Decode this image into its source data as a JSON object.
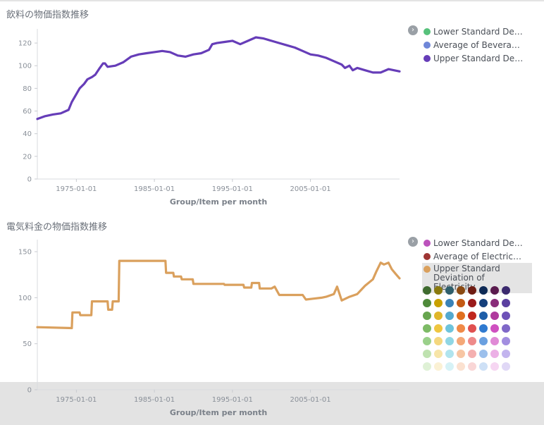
{
  "panels": [
    {
      "title": "飲料の物価指数推移",
      "xlabel": "Group/Item per month",
      "x_tick_labels": [
        "1975-01-01",
        "1985-01-01",
        "1995-01-01",
        "2005-01-01"
      ],
      "y_tick_labels": [
        "0",
        "20",
        "40",
        "60",
        "80",
        "100",
        "120"
      ],
      "legend": [
        {
          "label": "Lower Standard Devi...",
          "color": "#57c17b"
        },
        {
          "label": "Average of Beverages",
          "color": "#6f87d8"
        },
        {
          "label": "Upper Standard Devi...",
          "color": "#663db8"
        }
      ]
    },
    {
      "title": "電気料金の物価指数推移",
      "xlabel": "Group/Item per month",
      "x_tick_labels": [
        "1975-01-01",
        "1985-01-01",
        "1995-01-01",
        "2005-01-01"
      ],
      "y_tick_labels": [
        "0",
        "50",
        "100",
        "150"
      ],
      "legend": [
        {
          "label": "Lower Standard Devi...",
          "color": "#bc52bc"
        },
        {
          "label": "Average of Electricity",
          "color": "#9e3533"
        },
        {
          "label": "Upper Standard Deviation of Electricity",
          "color": "#daa05d"
        }
      ],
      "palette": [
        [
          "#3f6b2f",
          "#8a7a0e",
          "#2e5e6b",
          "#8a4a12",
          "#6e1c12",
          "#0e2a55",
          "#5a1b4e",
          "#3b2a6e"
        ],
        [
          "#4f8a3a",
          "#c9a100",
          "#3a82b8",
          "#c45a14",
          "#9a1b1b",
          "#15407c",
          "#8a2c7a",
          "#5a3fa0"
        ],
        [
          "#67a54f",
          "#e0b62a",
          "#54a9cf",
          "#e07020",
          "#c0271e",
          "#1e5ea8",
          "#b03a9e",
          "#6e52b8"
        ],
        [
          "#7dbb66",
          "#efc640",
          "#6ec4dc",
          "#f08a48",
          "#e05050",
          "#2f7ad0",
          "#cf50c0",
          "#8068c8"
        ],
        [
          "#9ad08a",
          "#f4d77e",
          "#90d6e4",
          "#f4a878",
          "#ee8a8a",
          "#6aa0e0",
          "#e08ad6",
          "#a28ee0"
        ],
        [
          "#bfe2b0",
          "#f7e5a8",
          "#b0e4ee",
          "#f7c6a4",
          "#f4b0b0",
          "#9cc0ec",
          "#ecb0e6",
          "#c2b4ee"
        ],
        [
          "#dff1d6",
          "#fbf1d4",
          "#d6f2f6",
          "#fbe1d0",
          "#f9d6d6",
          "#cde0f6",
          "#f6d6f2",
          "#e0d8f6"
        ]
      ]
    }
  ],
  "chart_data": [
    {
      "type": "line",
      "title": "飲料の物価指数推移",
      "xlabel": "Group/Item per month",
      "ylabel": "",
      "xlim": [
        "1970-01-01",
        "2016-06-01"
      ],
      "ylim": [
        0,
        130
      ],
      "x_ticks": [
        "1975-01-01",
        "1985-01-01",
        "1995-01-01",
        "2005-01-01"
      ],
      "y_ticks": [
        0,
        20,
        40,
        60,
        80,
        100,
        120
      ],
      "grid": false,
      "legend_position": "right",
      "series": [
        {
          "name": "Upper Standard Devi...",
          "color": "#663db8",
          "points": [
            [
              "1970-01-01",
              53
            ],
            [
              "1971-01-01",
              55.5
            ],
            [
              "1972-01-01",
              57
            ],
            [
              "1973-01-01",
              58
            ],
            [
              "1974-01-01",
              61
            ],
            [
              "1974-06-01",
              68
            ],
            [
              "1975-01-01",
              75
            ],
            [
              "1975-06-01",
              80
            ],
            [
              "1976-01-01",
              84
            ],
            [
              "1976-06-01",
              88
            ],
            [
              "1977-01-01",
              90
            ],
            [
              "1977-06-01",
              92
            ],
            [
              "1978-01-01",
              98
            ],
            [
              "1978-06-01",
              102
            ],
            [
              "1978-09-01",
              102
            ],
            [
              "1979-01-01",
              99
            ],
            [
              "1980-01-01",
              100
            ],
            [
              "1981-01-01",
              103
            ],
            [
              "1982-01-01",
              108
            ],
            [
              "1983-01-01",
              110
            ],
            [
              "1984-01-01",
              111
            ],
            [
              "1985-01-01",
              112
            ],
            [
              "1986-01-01",
              113
            ],
            [
              "1987-01-01",
              112
            ],
            [
              "1988-01-01",
              109
            ],
            [
              "1989-01-01",
              108
            ],
            [
              "1990-01-01",
              110
            ],
            [
              "1991-01-01",
              111
            ],
            [
              "1992-01-01",
              114
            ],
            [
              "1992-06-01",
              119
            ],
            [
              "1993-01-01",
              120
            ],
            [
              "1994-01-01",
              121
            ],
            [
              "1995-01-01",
              122
            ],
            [
              "1996-01-01",
              119
            ],
            [
              "1997-01-01",
              122
            ],
            [
              "1998-01-01",
              125
            ],
            [
              "1999-01-01",
              124
            ],
            [
              "2000-01-01",
              122
            ],
            [
              "2001-01-01",
              120
            ],
            [
              "2002-01-01",
              118
            ],
            [
              "2003-01-01",
              116
            ],
            [
              "2004-01-01",
              113
            ],
            [
              "2005-01-01",
              110
            ],
            [
              "2006-01-01",
              109
            ],
            [
              "2007-01-01",
              107
            ],
            [
              "2008-01-01",
              104
            ],
            [
              "2009-01-01",
              101
            ],
            [
              "2009-06-01",
              98
            ],
            [
              "2010-01-01",
              100
            ],
            [
              "2010-06-01",
              96
            ],
            [
              "2011-01-01",
              98
            ],
            [
              "2012-01-01",
              96
            ],
            [
              "2013-01-01",
              94
            ],
            [
              "2014-01-01",
              94
            ],
            [
              "2015-01-01",
              97
            ],
            [
              "2016-06-01",
              95
            ]
          ]
        }
      ]
    },
    {
      "type": "line",
      "title": "電気料金の物価指数推移",
      "xlabel": "Group/Item per month",
      "ylabel": "",
      "xlim": [
        "1970-01-01",
        "2016-06-01"
      ],
      "ylim": [
        0,
        160
      ],
      "x_ticks": [
        "1975-01-01",
        "1985-01-01",
        "1995-01-01",
        "2005-01-01"
      ],
      "y_ticks": [
        0,
        50,
        100,
        150
      ],
      "grid": false,
      "legend_position": "right",
      "series": [
        {
          "name": "Upper Standard Deviation of Electricity",
          "color": "#daa05d",
          "points": [
            [
              "1970-01-01",
              68
            ],
            [
              "1974-06-01",
              67
            ],
            [
              "1974-07-01",
              84
            ],
            [
              "1975-06-01",
              84
            ],
            [
              "1975-07-01",
              81
            ],
            [
              "1976-12-01",
              81
            ],
            [
              "1977-01-01",
              96
            ],
            [
              "1979-01-01",
              96
            ],
            [
              "1979-02-01",
              87
            ],
            [
              "1979-08-01",
              87
            ],
            [
              "1979-09-01",
              96
            ],
            [
              "1980-06-01",
              96
            ],
            [
              "1980-07-01",
              140
            ],
            [
              "1986-06-01",
              140
            ],
            [
              "1986-07-01",
              127
            ],
            [
              "1987-06-01",
              127
            ],
            [
              "1987-07-01",
              123
            ],
            [
              "1988-06-01",
              123
            ],
            [
              "1988-07-01",
              120
            ],
            [
              "1989-12-01",
              120
            ],
            [
              "1990-01-01",
              115
            ],
            [
              "1993-12-01",
              115
            ],
            [
              "1994-01-01",
              114
            ],
            [
              "1996-06-01",
              114
            ],
            [
              "1996-07-01",
              111
            ],
            [
              "1997-06-01",
              111
            ],
            [
              "1997-07-01",
              116
            ],
            [
              "1998-06-01",
              116
            ],
            [
              "1998-07-01",
              110
            ],
            [
              "2000-01-01",
              110
            ],
            [
              "2000-06-01",
              112
            ],
            [
              "2001-01-01",
              103
            ],
            [
              "2004-01-01",
              103
            ],
            [
              "2004-06-01",
              98
            ],
            [
              "2005-06-01",
              99
            ],
            [
              "2006-06-01",
              100
            ],
            [
              "2007-01-01",
              101
            ],
            [
              "2008-01-01",
              104
            ],
            [
              "2008-06-01",
              112
            ],
            [
              "2009-01-01",
              97
            ],
            [
              "2010-01-01",
              101
            ],
            [
              "2011-01-01",
              104
            ],
            [
              "2012-01-01",
              113
            ],
            [
              "2013-01-01",
              120
            ],
            [
              "2013-06-01",
              128
            ],
            [
              "2014-01-01",
              138
            ],
            [
              "2014-06-01",
              136
            ],
            [
              "2015-01-01",
              138
            ],
            [
              "2015-06-01",
              131
            ],
            [
              "2016-01-01",
              125
            ],
            [
              "2016-06-01",
              121
            ]
          ]
        }
      ]
    }
  ]
}
